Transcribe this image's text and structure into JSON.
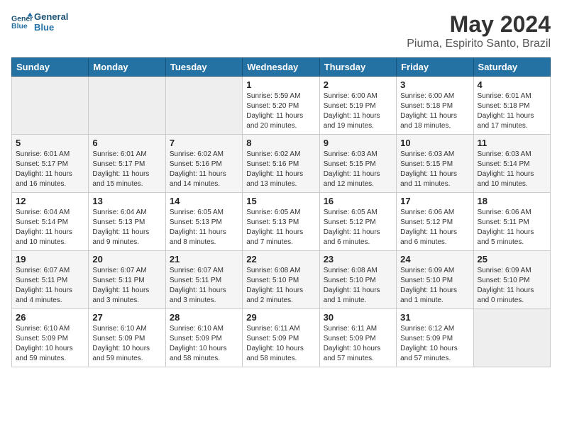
{
  "header": {
    "logo_line1": "General",
    "logo_line2": "Blue",
    "title": "May 2024",
    "subtitle": "Piuma, Espirito Santo, Brazil"
  },
  "weekdays": [
    "Sunday",
    "Monday",
    "Tuesday",
    "Wednesday",
    "Thursday",
    "Friday",
    "Saturday"
  ],
  "weeks": [
    [
      {
        "day": "",
        "info": ""
      },
      {
        "day": "",
        "info": ""
      },
      {
        "day": "",
        "info": ""
      },
      {
        "day": "1",
        "info": "Sunrise: 5:59 AM\nSunset: 5:20 PM\nDaylight: 11 hours\nand 20 minutes."
      },
      {
        "day": "2",
        "info": "Sunrise: 6:00 AM\nSunset: 5:19 PM\nDaylight: 11 hours\nand 19 minutes."
      },
      {
        "day": "3",
        "info": "Sunrise: 6:00 AM\nSunset: 5:18 PM\nDaylight: 11 hours\nand 18 minutes."
      },
      {
        "day": "4",
        "info": "Sunrise: 6:01 AM\nSunset: 5:18 PM\nDaylight: 11 hours\nand 17 minutes."
      }
    ],
    [
      {
        "day": "5",
        "info": "Sunrise: 6:01 AM\nSunset: 5:17 PM\nDaylight: 11 hours\nand 16 minutes."
      },
      {
        "day": "6",
        "info": "Sunrise: 6:01 AM\nSunset: 5:17 PM\nDaylight: 11 hours\nand 15 minutes."
      },
      {
        "day": "7",
        "info": "Sunrise: 6:02 AM\nSunset: 5:16 PM\nDaylight: 11 hours\nand 14 minutes."
      },
      {
        "day": "8",
        "info": "Sunrise: 6:02 AM\nSunset: 5:16 PM\nDaylight: 11 hours\nand 13 minutes."
      },
      {
        "day": "9",
        "info": "Sunrise: 6:03 AM\nSunset: 5:15 PM\nDaylight: 11 hours\nand 12 minutes."
      },
      {
        "day": "10",
        "info": "Sunrise: 6:03 AM\nSunset: 5:15 PM\nDaylight: 11 hours\nand 11 minutes."
      },
      {
        "day": "11",
        "info": "Sunrise: 6:03 AM\nSunset: 5:14 PM\nDaylight: 11 hours\nand 10 minutes."
      }
    ],
    [
      {
        "day": "12",
        "info": "Sunrise: 6:04 AM\nSunset: 5:14 PM\nDaylight: 11 hours\nand 10 minutes."
      },
      {
        "day": "13",
        "info": "Sunrise: 6:04 AM\nSunset: 5:13 PM\nDaylight: 11 hours\nand 9 minutes."
      },
      {
        "day": "14",
        "info": "Sunrise: 6:05 AM\nSunset: 5:13 PM\nDaylight: 11 hours\nand 8 minutes."
      },
      {
        "day": "15",
        "info": "Sunrise: 6:05 AM\nSunset: 5:13 PM\nDaylight: 11 hours\nand 7 minutes."
      },
      {
        "day": "16",
        "info": "Sunrise: 6:05 AM\nSunset: 5:12 PM\nDaylight: 11 hours\nand 6 minutes."
      },
      {
        "day": "17",
        "info": "Sunrise: 6:06 AM\nSunset: 5:12 PM\nDaylight: 11 hours\nand 6 minutes."
      },
      {
        "day": "18",
        "info": "Sunrise: 6:06 AM\nSunset: 5:11 PM\nDaylight: 11 hours\nand 5 minutes."
      }
    ],
    [
      {
        "day": "19",
        "info": "Sunrise: 6:07 AM\nSunset: 5:11 PM\nDaylight: 11 hours\nand 4 minutes."
      },
      {
        "day": "20",
        "info": "Sunrise: 6:07 AM\nSunset: 5:11 PM\nDaylight: 11 hours\nand 3 minutes."
      },
      {
        "day": "21",
        "info": "Sunrise: 6:07 AM\nSunset: 5:11 PM\nDaylight: 11 hours\nand 3 minutes."
      },
      {
        "day": "22",
        "info": "Sunrise: 6:08 AM\nSunset: 5:10 PM\nDaylight: 11 hours\nand 2 minutes."
      },
      {
        "day": "23",
        "info": "Sunrise: 6:08 AM\nSunset: 5:10 PM\nDaylight: 11 hours\nand 1 minute."
      },
      {
        "day": "24",
        "info": "Sunrise: 6:09 AM\nSunset: 5:10 PM\nDaylight: 11 hours\nand 1 minute."
      },
      {
        "day": "25",
        "info": "Sunrise: 6:09 AM\nSunset: 5:10 PM\nDaylight: 11 hours\nand 0 minutes."
      }
    ],
    [
      {
        "day": "26",
        "info": "Sunrise: 6:10 AM\nSunset: 5:09 PM\nDaylight: 10 hours\nand 59 minutes."
      },
      {
        "day": "27",
        "info": "Sunrise: 6:10 AM\nSunset: 5:09 PM\nDaylight: 10 hours\nand 59 minutes."
      },
      {
        "day": "28",
        "info": "Sunrise: 6:10 AM\nSunset: 5:09 PM\nDaylight: 10 hours\nand 58 minutes."
      },
      {
        "day": "29",
        "info": "Sunrise: 6:11 AM\nSunset: 5:09 PM\nDaylight: 10 hours\nand 58 minutes."
      },
      {
        "day": "30",
        "info": "Sunrise: 6:11 AM\nSunset: 5:09 PM\nDaylight: 10 hours\nand 57 minutes."
      },
      {
        "day": "31",
        "info": "Sunrise: 6:12 AM\nSunset: 5:09 PM\nDaylight: 10 hours\nand 57 minutes."
      },
      {
        "day": "",
        "info": ""
      }
    ]
  ]
}
